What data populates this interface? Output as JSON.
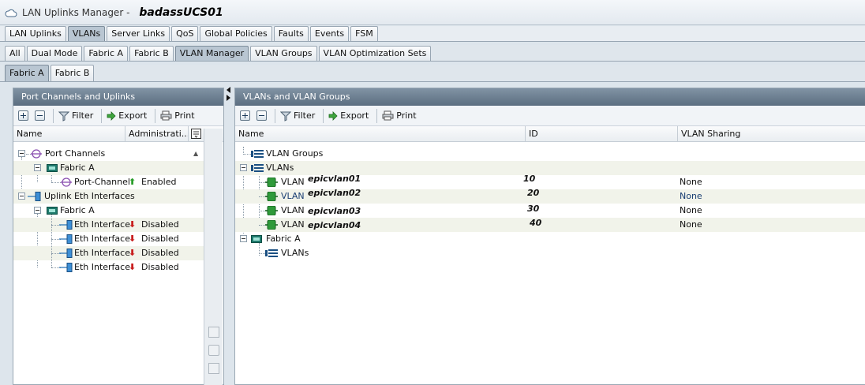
{
  "window": {
    "title": "LAN Uplinks Manager -",
    "hostname": "badassUCS01"
  },
  "tabs_main": [
    "LAN Uplinks",
    "VLANs",
    "Server Links",
    "QoS",
    "Global Policies",
    "Faults",
    "Events",
    "FSM"
  ],
  "tabs_main_active": "VLANs",
  "tabs_vlans": [
    "All",
    "Dual Mode",
    "Fabric A",
    "Fabric B",
    "VLAN Manager",
    "VLAN Groups",
    "VLAN Optimization Sets"
  ],
  "tabs_vlans_active": "VLAN Manager",
  "tabs_fabric": [
    "Fabric A",
    "Fabric B"
  ],
  "tabs_fabric_active": "Fabric A",
  "left_panel": {
    "title": "Port Channels and Uplinks",
    "toolbar": {
      "filter": "Filter",
      "export": "Export",
      "print": "Print"
    },
    "columns": {
      "name": "Name",
      "admin": "Administrati..."
    },
    "tree": [
      {
        "label": "Port Channels"
      },
      {
        "label": "Fabric A"
      },
      {
        "label": "Port-Channel",
        "state": "Enabled"
      },
      {
        "label": "Uplink Eth Interfaces"
      },
      {
        "label": "Fabric A"
      },
      {
        "label": "Eth Interface",
        "state": "Disabled"
      },
      {
        "label": "Eth Interface",
        "state": "Disabled"
      },
      {
        "label": "Eth Interface",
        "state": "Disabled"
      },
      {
        "label": "Eth Interface",
        "state": "Disabled"
      }
    ]
  },
  "right_panel": {
    "title": "VLANs and VLAN Groups",
    "toolbar": {
      "filter": "Filter",
      "export": "Export",
      "print": "Print"
    },
    "columns": {
      "name": "Name",
      "id": "ID",
      "sharing": "VLAN Sharing"
    },
    "tree": [
      {
        "label": "VLAN Groups"
      },
      {
        "label": "VLANs"
      },
      {
        "label": "VLAN",
        "vlan_name": "epicvlan01",
        "id": "10",
        "sharing": "None"
      },
      {
        "label": "VLAN",
        "vlan_name": "epicvlan02",
        "id": "20",
        "sharing": "None"
      },
      {
        "label": "VLAN",
        "vlan_name": "epicvlan03",
        "id": "30",
        "sharing": "None"
      },
      {
        "label": "VLAN",
        "vlan_name": "epicvlan04",
        "id": "40",
        "sharing": "None"
      },
      {
        "label": "Fabric A"
      },
      {
        "label": "VLANs"
      }
    ]
  },
  "colors": {
    "panel_header": "#6b7e90",
    "enabled_arrow": "#2a9d2a",
    "disabled_arrow": "#c81e1e",
    "alt_row": "#f1f3ea"
  }
}
